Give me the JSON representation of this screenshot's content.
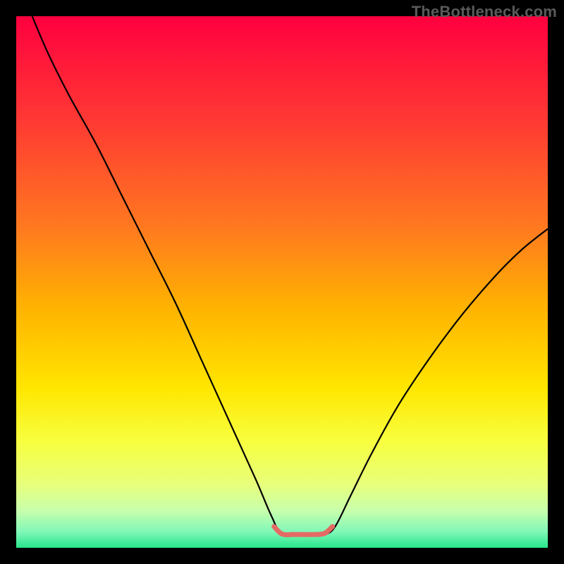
{
  "watermark": "TheBottleneck.com",
  "chart_data": {
    "type": "line",
    "title": "",
    "xlabel": "",
    "ylabel": "",
    "xlim": [
      0,
      100
    ],
    "ylim": [
      0,
      100
    ],
    "grid": false,
    "legend": false,
    "annotations": [],
    "background": {
      "type": "vertical-gradient",
      "stops": [
        {
          "offset": 0.0,
          "color": "#ff003f"
        },
        {
          "offset": 0.2,
          "color": "#ff3a33"
        },
        {
          "offset": 0.4,
          "color": "#ff7a1f"
        },
        {
          "offset": 0.55,
          "color": "#ffb300"
        },
        {
          "offset": 0.7,
          "color": "#ffe600"
        },
        {
          "offset": 0.8,
          "color": "#f7ff3f"
        },
        {
          "offset": 0.88,
          "color": "#e8ff7a"
        },
        {
          "offset": 0.93,
          "color": "#c8ffac"
        },
        {
          "offset": 0.97,
          "color": "#80f7b8"
        },
        {
          "offset": 1.0,
          "color": "#27e58b"
        }
      ]
    },
    "series": [
      {
        "name": "curve",
        "color": "#000000",
        "width": 2.2,
        "x": [
          3,
          6,
          10,
          15,
          20,
          25,
          30,
          35,
          40,
          45,
          48,
          50,
          53,
          56,
          58,
          60,
          63,
          67,
          72,
          78,
          84,
          90,
          95,
          100
        ],
        "y": [
          100,
          93,
          85,
          76,
          66,
          56,
          46,
          35,
          24,
          13,
          6,
          2.5,
          2.5,
          2.5,
          2.5,
          4,
          10,
          18,
          27,
          36,
          44,
          51,
          56,
          60
        ]
      },
      {
        "name": "bottom-highlight",
        "color": "#e46a64",
        "width": 7,
        "linecap": "round",
        "x": [
          48.5,
          50,
          52,
          54,
          56,
          58,
          59.5
        ],
        "y": [
          4.0,
          2.6,
          2.5,
          2.5,
          2.5,
          2.7,
          4.0
        ]
      }
    ]
  }
}
